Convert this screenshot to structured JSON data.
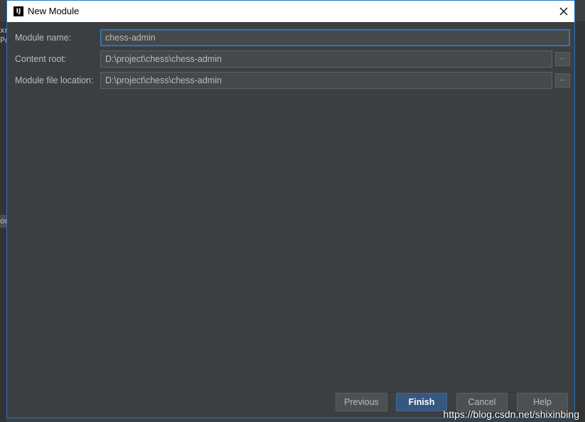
{
  "background": {
    "left_fragment_top": "xr\nPc",
    "left_fragment_mid": "or"
  },
  "dialog": {
    "title": "New Module",
    "fields": [
      {
        "label": "Module name:",
        "value": "chess-admin"
      },
      {
        "label": "Content root:",
        "value": "D:\\project\\chess\\chess-admin"
      },
      {
        "label": "Module file location:",
        "value": "D:\\project\\chess\\chess-admin"
      }
    ],
    "browse_label": "...",
    "buttons": {
      "previous": "Previous",
      "finish": "Finish",
      "cancel": "Cancel",
      "help": "Help"
    }
  },
  "watermark": "https://blog.csdn.net/shixinbing",
  "colors": {
    "accent": "#2675bf",
    "background": "#3c3f41",
    "default_button": "#365880"
  }
}
